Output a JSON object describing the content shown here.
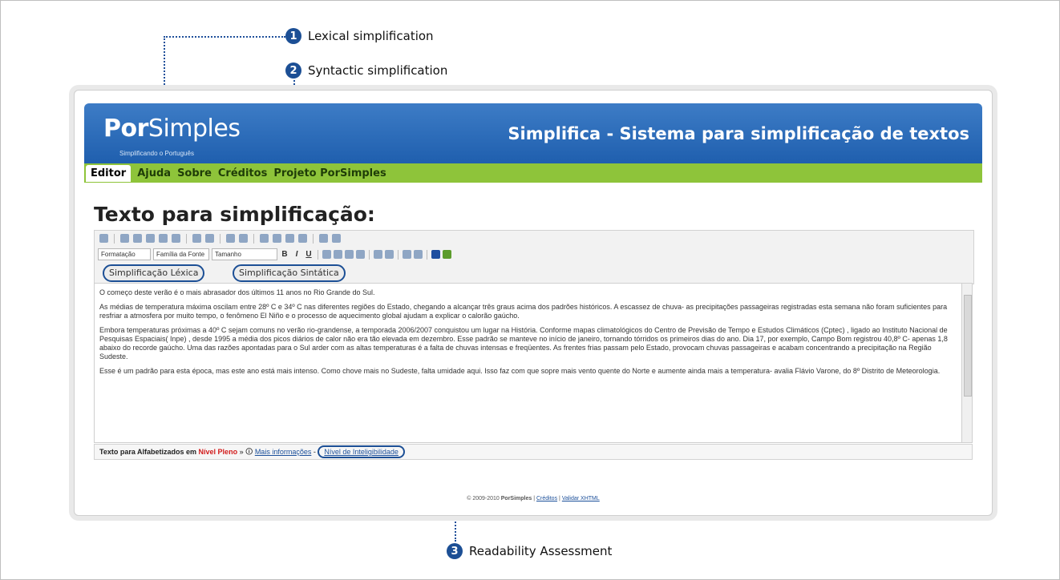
{
  "callouts": [
    {
      "num": "1",
      "label": "Lexical simplification"
    },
    {
      "num": "2",
      "label": "Syntactic simplification"
    },
    {
      "num": "3",
      "label": "Readability Assessment"
    }
  ],
  "app": {
    "logo_part1": "Por",
    "logo_part2": "Simples",
    "logo_sub": "Simplificando o Português",
    "site_title": "Simplifica - Sistema para simplificação de textos",
    "nav": [
      "Editor",
      "Ajuda",
      "Sobre",
      "Créditos",
      "Projeto PorSimples"
    ],
    "page_title": "Texto para simplificação:",
    "toolbar": {
      "format_select": "Formatação",
      "font_select": "Família da Fonte",
      "size_select": "Tamanho",
      "bold": "B",
      "italic": "I",
      "underline": "U"
    },
    "tabs": {
      "lexical": "Simplificação Léxica",
      "syntactic": "Simplificação Sintática"
    },
    "paragraphs": [
      "O começo deste verão é o mais abrasador dos últimos 11 anos no Rio Grande do Sul.",
      "As médias de temperatura máxima oscilam entre 28º C e 34º C nas diferentes regiões do Estado, chegando a alcançar três graus acima dos padrões históricos. A escassez de chuva- as precipitações passageiras registradas esta semana não foram suficientes para resfriar a atmosfera por muito tempo, o fenômeno El Niño e o processo de aquecimento global ajudam a explicar o calorão gaúcho.",
      "Embora temperaturas próximas a 40º C sejam comuns no verão rio-grandense, a temporada 2006/2007 conquistou um lugar na História. Conforme mapas climatológicos do Centro de Previsão de Tempo e Estudos Climáticos (Cptec) , ligado ao Instituto Nacional de Pesquisas Espaciais( Inpe) , desde 1995 a média dos picos diários de calor não era tão elevada em dezembro. Esse padrão se manteve no início de janeiro, tornando tórridos os primeiros dias do ano. Dia 17, por exemplo, Campo Bom registrou 40,8º C- apenas 1,8 abaixo do recorde gaúcho. Uma das razões apontadas para o Sul arder com as altas temperaturas é a falta de chuvas intensas e freqüentes. As frentes frias passam pelo Estado, provocam chuvas passageiras e acabam concentrando a precipitação na Região Sudeste.",
      "Esse é um padrão para esta época, mas este ano está mais intenso. Como chove mais no Sudeste, falta umidade aqui. Isso faz com que sopre mais vento quente do Norte e aumente ainda mais a temperatura- avalia Flávio Varone, do 8º Distrito de Meteorologia."
    ],
    "status": {
      "prefix": "Texto para Alfabetizados em",
      "level": "Nível Pleno",
      "sep1": "»",
      "more_info": "Mais informações",
      "sep2": "-",
      "intelligibility": "Nível de Inteligibilidade"
    },
    "footer": {
      "copyright": "© 2009-2010",
      "brand": "PorSimples",
      "sep": "|",
      "credits": "Créditos",
      "validate": "Validar XHTML"
    }
  }
}
